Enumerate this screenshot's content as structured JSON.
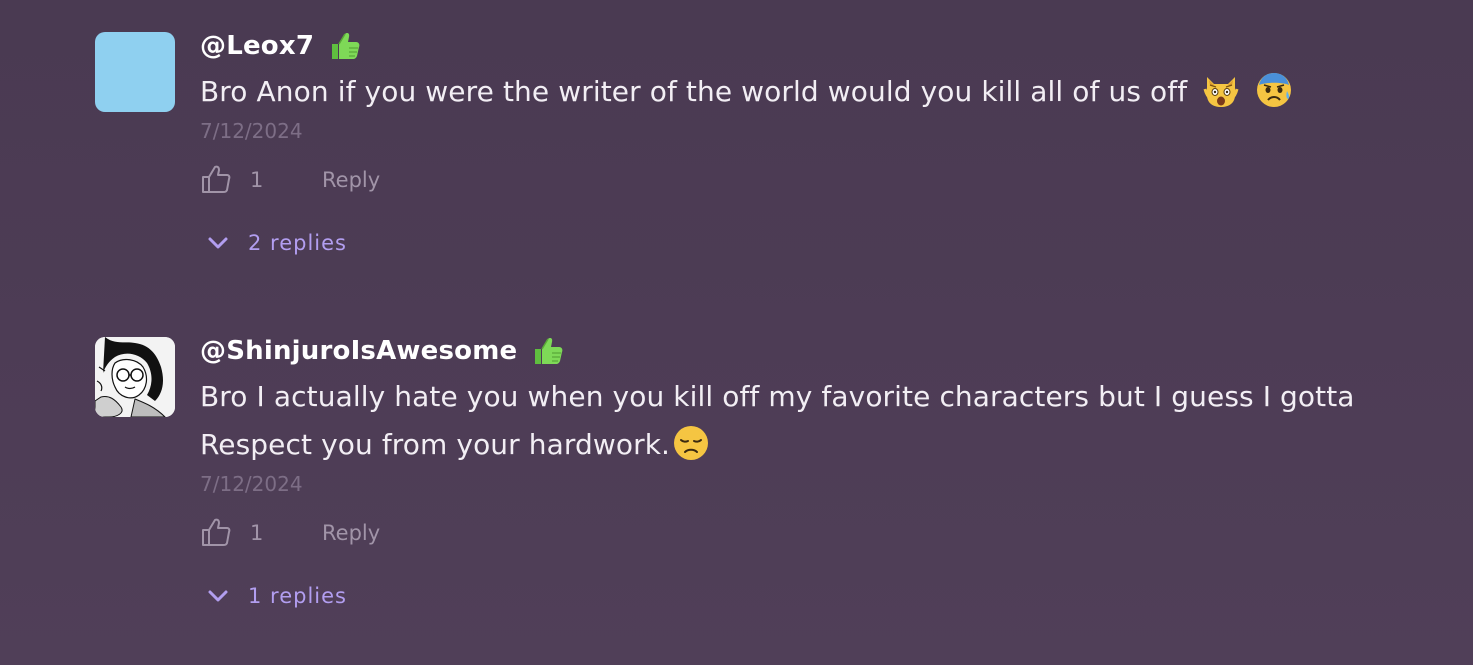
{
  "comments": [
    {
      "username": "@Leox7",
      "badge_icon": "thumbs-up-badge-icon",
      "text": "Bro Anon if you were the writer of the world would you kill all of us off",
      "emojis": [
        "weary-cat-face-icon",
        "anxious-face-with-sweat-icon"
      ],
      "date": "7/12/2024",
      "likes": "1",
      "reply_label": "Reply",
      "replies_label": "2 replies",
      "avatar_color": "#8fd0f0"
    },
    {
      "username": "@ShinjuroIsAwesome",
      "badge_icon": "thumbs-up-badge-icon",
      "text_line1": "Bro I actually hate you when you kill off my favorite characters but I guess I gotta",
      "text_line2": "Respect you from your hardwork.",
      "emojis": [
        "disappointed-face-icon"
      ],
      "date": "7/12/2024",
      "likes": "1",
      "reply_label": "Reply",
      "replies_label": "1 replies"
    }
  ],
  "colors": {
    "background": "#4d3c55",
    "date": "#7d6e86",
    "action": "#a194a8",
    "replies_accent": "#b29ef0",
    "badge_green": "#7ed957"
  }
}
